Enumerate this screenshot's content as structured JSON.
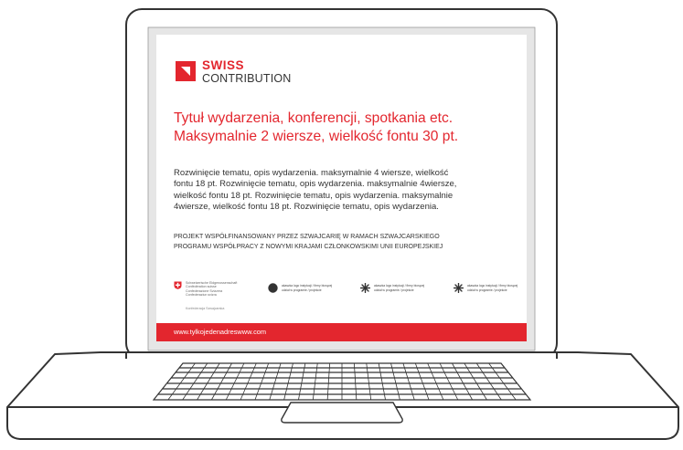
{
  "brand": {
    "name_top": "SWISS",
    "name_bottom": "CONTRIBUTION",
    "color": "#e3262e"
  },
  "headline": {
    "line1": "Tytuł wydarzenia, konferencji, spotkania etc.",
    "line2": "Maksymalnie 2 wiersze, wielkość fontu 30 pt."
  },
  "body": {
    "lines": [
      "Rozwinięcie tematu, opis wydarzenia. maksymalnie 4 wiersze, wielkość",
      "fontu 18 pt. Rozwinięcie tematu, opis wydarzenia. maksymalnie 4wiersze,",
      "wielkość fontu 18 pt. Rozwinięcie tematu, opis wydarzenia. maksymalnie",
      "4wiersze, wielkość fontu 18 pt. Rozwinięcie tematu, opis wydarzenia."
    ]
  },
  "project_note": {
    "line1": "PROJEKT WSPÓŁFINANSOWANY PRZEZ SZWAJCARIĘ  W RAMACH SZWAJCARSKIEGO",
    "line2": "PROGRAMU WSPÓŁPRACY  Z NOWYMI KRAJAMI CZŁONKOWSKIMI UNII EUROPEJSKIEJ"
  },
  "swiss_gov": {
    "lines": [
      "Schweizerische Eidgenossenschaft",
      "Confédération suisse",
      "Confederazione Svizzera",
      "Confederaziun svizra"
    ],
    "extra": "Konfederacja Szwajcarska"
  },
  "partners": [
    {
      "icon": "circle-logo-icon",
      "line1": "akaszka logo instytucji / firmy biorącej",
      "line2": "udział w programie / projekcie"
    },
    {
      "icon": "star-logo-icon",
      "line1": "akaszka logo instytucji / firmy biorącej",
      "line2": "udział w programie / projekcie"
    },
    {
      "icon": "star-logo-icon",
      "line1": "akaszka logo instytucji / firmy biorącej",
      "line2": "udział w programie / projekcie"
    }
  ],
  "footer": {
    "url": "www.tylkojedenadreswww.com"
  }
}
